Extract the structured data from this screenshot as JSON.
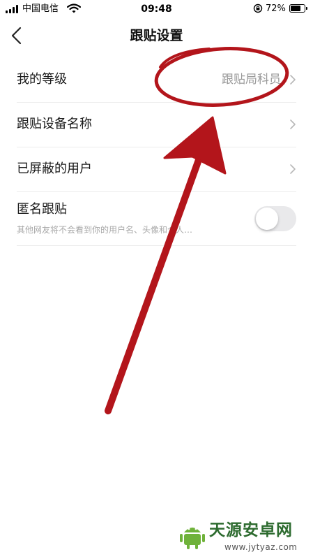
{
  "status_bar": {
    "carrier": "中国电信",
    "time": "09:48",
    "battery_percent": "72%",
    "battery_level": 0.72,
    "icons": [
      "signal-icon",
      "wifi-icon",
      "lock-rotation-icon",
      "battery-icon"
    ]
  },
  "nav": {
    "title": "跟贴设置",
    "back_icon": "chevron-left-icon"
  },
  "settings": {
    "level": {
      "label": "我的等级",
      "value": "跟贴局科员"
    },
    "device_name": {
      "label": "跟贴设备名称"
    },
    "blocked_users": {
      "label": "已屏蔽的用户"
    },
    "anonymous": {
      "label": "匿名跟贴",
      "description": "其他网友将不会看到你的用户名、头像和个人…",
      "enabled": false
    }
  },
  "annotation": {
    "color": "#b3151b",
    "shapes": [
      "ellipse-highlight",
      "arrow"
    ]
  },
  "watermark": {
    "text": "天源安卓网",
    "url": "www.jytyaz.com",
    "color": "#2d6b2f"
  }
}
